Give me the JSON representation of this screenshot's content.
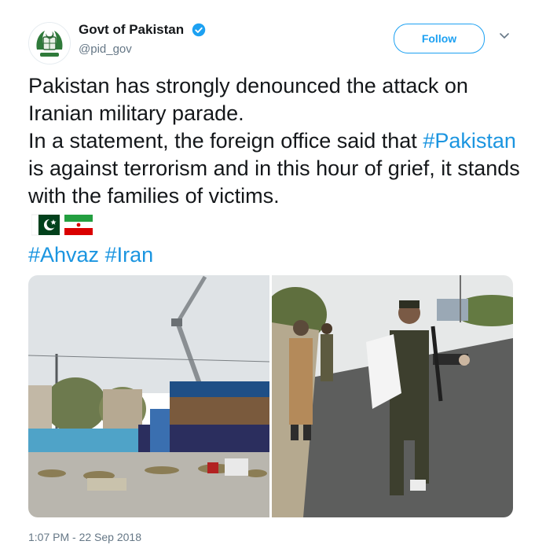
{
  "account": {
    "display_name": "Govt of Pakistan",
    "handle": "@pid_gov",
    "verified_icon": "verified-badge-icon"
  },
  "actions": {
    "follow_label": "Follow",
    "more_icon": "chevron-down-icon"
  },
  "tweet": {
    "line1": "Pakistan has strongly denounced the attack on Iranian military parade.",
    "line2_pre": "In a statement, the foreign office said that ",
    "line2_hashtag": "#Pakistan",
    "line2_post": " is against terrorism and in this hour of grief, it stands with the families of victims.",
    "flags": [
      "pakistan-flag-emoji",
      "iran-flag-emoji"
    ],
    "hashtags": [
      "#Ahvaz",
      "#Iran"
    ]
  },
  "media": {
    "photos": [
      "parade-attack-stands-photo",
      "soldier-carrying-child-photo"
    ]
  },
  "meta": {
    "timestamp": "1:07 PM - 22 Sep 2018"
  },
  "colors": {
    "brand": "#1da1f2",
    "link": "#1b95e0",
    "muted": "#657786"
  }
}
